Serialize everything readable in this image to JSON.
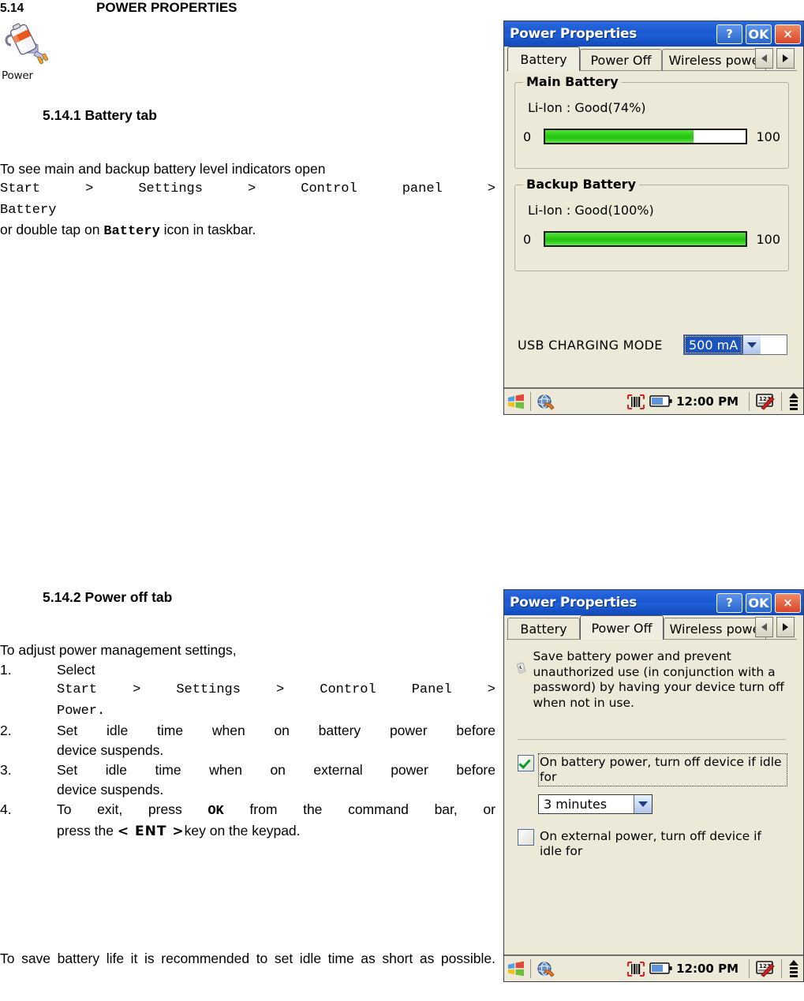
{
  "document": {
    "section_number": "5.14",
    "section_title": "POWER PROPERTIES",
    "power_icon_label": "Power",
    "subsection1_title": "5.14.1 Battery tab",
    "subsection2_title": "5.14.2 Power off tab",
    "para1_line1": "To see main and backup battery level indicators open",
    "para1_path": "Start > Settings > Control panel >",
    "para1_path2": "Battery",
    "para1_line3_a": "or double tap on ",
    "para1_line3_b": "Battery",
    "para1_line3_c": " icon in taskbar.",
    "para2_intro": "To adjust power management settings,",
    "list": [
      {
        "num": "1.",
        "text": "Select",
        "path": "Start > Settings > Control Panel >",
        "path2": "Power."
      },
      {
        "num": "2.",
        "line1": "Set idle time when on battery power before",
        "line2": "device suspends."
      },
      {
        "num": "3.",
        "line1": "Set idle time when on external power before",
        "line2": "device suspends."
      },
      {
        "num": "4.",
        "line1_a": "To exit, press ",
        "line1_b": "OK",
        "line1_c": " from the command bar, or",
        "line2_a": "press the ",
        "line2_b": "< ENT >",
        "line2_c": "key on the keypad."
      }
    ],
    "para3": "To save battery life it is recommended to set idle time as short as possible."
  },
  "dialog_battery": {
    "title": "Power Properties",
    "buttons": {
      "help": "?",
      "ok": "OK",
      "close": "×"
    },
    "tabs": [
      {
        "label": "Battery",
        "active": true
      },
      {
        "label": "Power Off",
        "active": false
      },
      {
        "label": "Wireless powe",
        "active": false
      }
    ],
    "main_battery": {
      "group_title": "Main Battery",
      "status": "Li-Ion : Good(74%)",
      "min": "0",
      "max": "100",
      "percent": 74
    },
    "backup_battery": {
      "group_title": "Backup Battery",
      "status": "Li-Ion : Good(100%)",
      "min": "0",
      "max": "100",
      "percent": 100
    },
    "usb": {
      "label": "USB CHARGING MODE",
      "value": "500 mA"
    },
    "taskbar": {
      "time": "12:00 PM"
    }
  },
  "dialog_poweroff": {
    "title": "Power Properties",
    "buttons": {
      "help": "?",
      "ok": "OK",
      "close": "×"
    },
    "tabs": [
      {
        "label": "Battery",
        "active": false
      },
      {
        "label": "Power Off",
        "active": true
      },
      {
        "label": "Wireless powe",
        "active": false
      }
    ],
    "description": "Save battery power and prevent unauthorized use (in conjunction with a password) by having your device turn off when not in use.",
    "battery_option": {
      "label": "On battery power, turn off device if idle for",
      "checked": true,
      "idle_value": "3 minutes"
    },
    "external_option": {
      "label": "On external power, turn off device if idle for",
      "checked": false
    },
    "taskbar": {
      "time": "12:00 PM"
    }
  },
  "colors": {
    "titlebar_blue": "#1a57d0",
    "close_red": "#d8452a",
    "dialog_face": "#ece9d8",
    "progress_green": "#2ecc17",
    "selection_blue": "#1c53bd",
    "check_green": "#0a9c2e"
  }
}
